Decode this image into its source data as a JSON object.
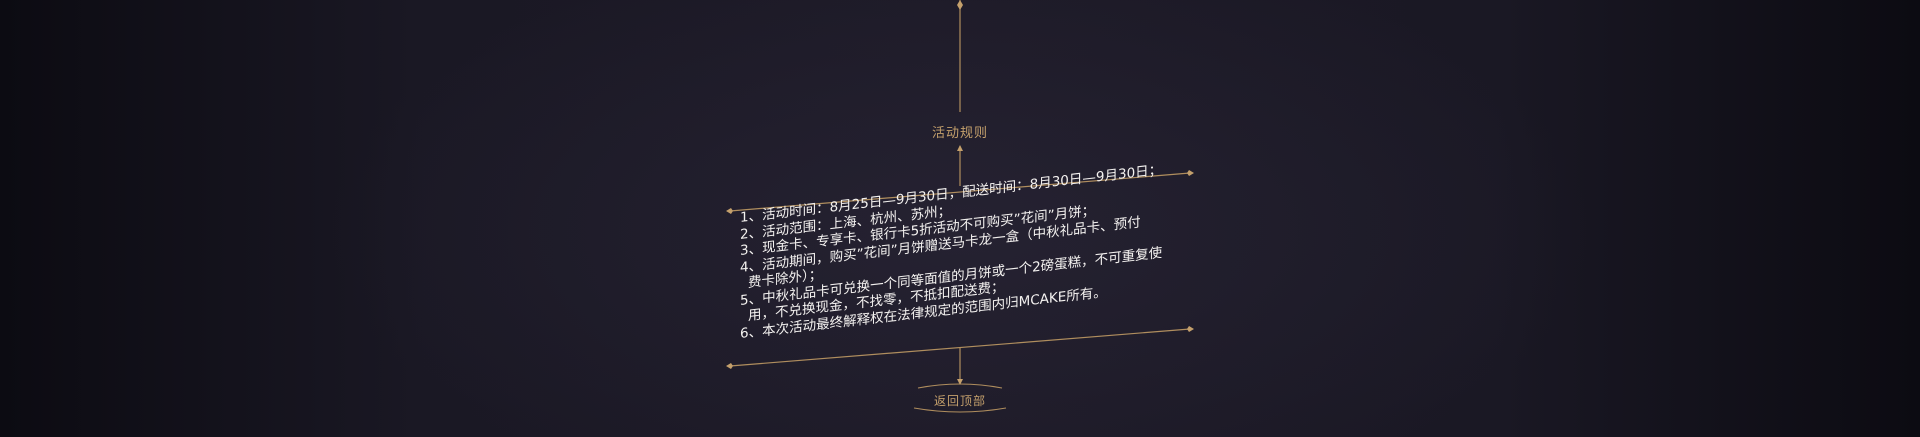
{
  "rules": {
    "title": "活动规则",
    "lines": [
      "1、活动时间：8月25日—9月30日，配送时间：8月30日—9月30日；",
      "2、活动范围：上海、杭州、苏州；",
      "3、现金卡、专享卡、银行卡5折活动不可购买”花间”月饼；",
      "4、活动期间，购买”花间”月饼赠送马卡龙一盒（中秋礼品卡、预付",
      "费卡除外）；",
      "5、中秋礼品卡可兑换一个同等面值的月饼或一个2磅蛋糕，不可重复使",
      "用，不兑换现金，不找零，不抵扣配送费；",
      "6、本次活动最终解释权在法律规定的范围内归MCAKE所有。"
    ]
  },
  "footer": {
    "back_to_top_label": "返回顶部"
  },
  "colors": {
    "accent_gold": "#c4a06c",
    "text": "#f4f2f0",
    "background": "#14121c"
  }
}
